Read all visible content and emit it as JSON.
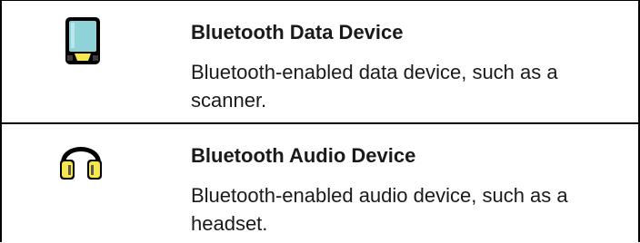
{
  "rows": [
    {
      "icon": "bluetooth-data-device-icon",
      "title": "Bluetooth Data Device",
      "description": "Bluetooth-enabled data device, such as a scanner."
    },
    {
      "icon": "bluetooth-audio-device-icon",
      "title": "Bluetooth Audio Device",
      "description": "Bluetooth-enabled audio device, such as a headset."
    }
  ],
  "colors": {
    "data_device_screen": "#8fd3d8",
    "data_device_base": "#f6e84c",
    "audio_device_yellow": "#f6e84c",
    "audio_device_white": "#ffffff",
    "outline": "#000000"
  }
}
